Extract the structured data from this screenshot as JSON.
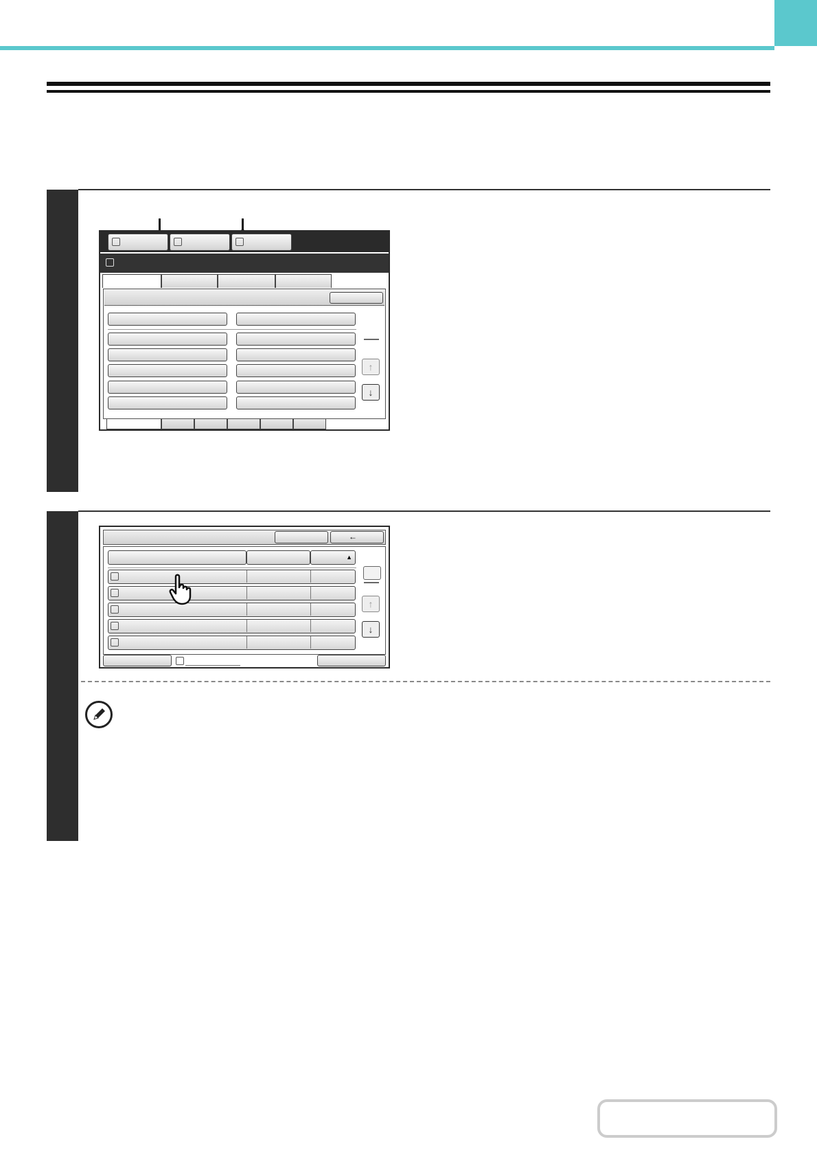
{
  "header": {
    "accent_color": "#5bc8cd"
  },
  "step1": {
    "screen": {
      "mode_icon_names": [
        "copy-mode-icon",
        "scan-mode-icon",
        "print-mode-icon"
      ],
      "status_icon": "job-status-icon",
      "arrow_up": "↑",
      "arrow_down": "↓"
    }
  },
  "step2": {
    "screen": {
      "back_arrow": "←",
      "sort_arrow": "▲",
      "arrow_up": "↑",
      "arrow_down": "↓",
      "row_icons": [
        "fax-icon",
        "scan-to-icon",
        "print-icon",
        "fax-icon",
        "print-icon"
      ],
      "hand_pointer": "hand-pointer-icon"
    },
    "note_icon": "pencil-icon"
  }
}
